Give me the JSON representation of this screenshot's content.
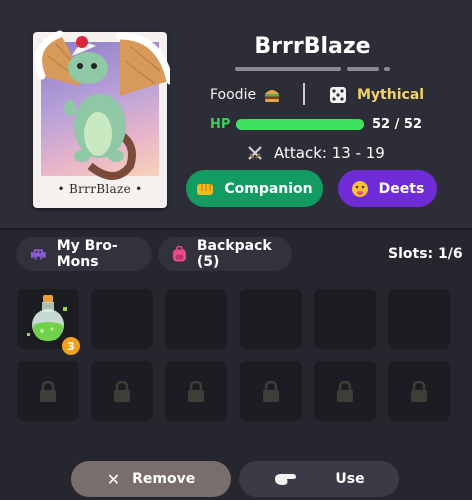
{
  "pet": {
    "name": "BrrrBlaze",
    "card_name": "• BrrrBlaze •",
    "trait": "Foodie",
    "trait_icon": "burger-icon",
    "rarity": "Mythical",
    "rarity_icon": "dice-icon",
    "hp_label": "HP",
    "hp_value": "52 / 52",
    "hp_fraction": 1.0,
    "attack": "Attack: 13 - 19",
    "attack_icon": "crossed-swords-icon"
  },
  "actions": {
    "companion_label": "Companion",
    "deets_label": "Deets"
  },
  "tabs": {
    "mons_label": "My Bro-Mons",
    "backpack_label": "Backpack (5)",
    "slots": "Slots: 1/6"
  },
  "inventory": {
    "items": [
      {
        "icon": "green-potion-icon",
        "count": "3"
      }
    ],
    "locked_icon": "lock-icon"
  },
  "bottom": {
    "remove_label": "Remove",
    "use_label": "Use"
  },
  "colors": {
    "companion": "#139c62",
    "deets": "#6f2bd6",
    "rarity": "#f0d36b",
    "hp": "#3ee25f",
    "badge": "#f2a21a"
  }
}
